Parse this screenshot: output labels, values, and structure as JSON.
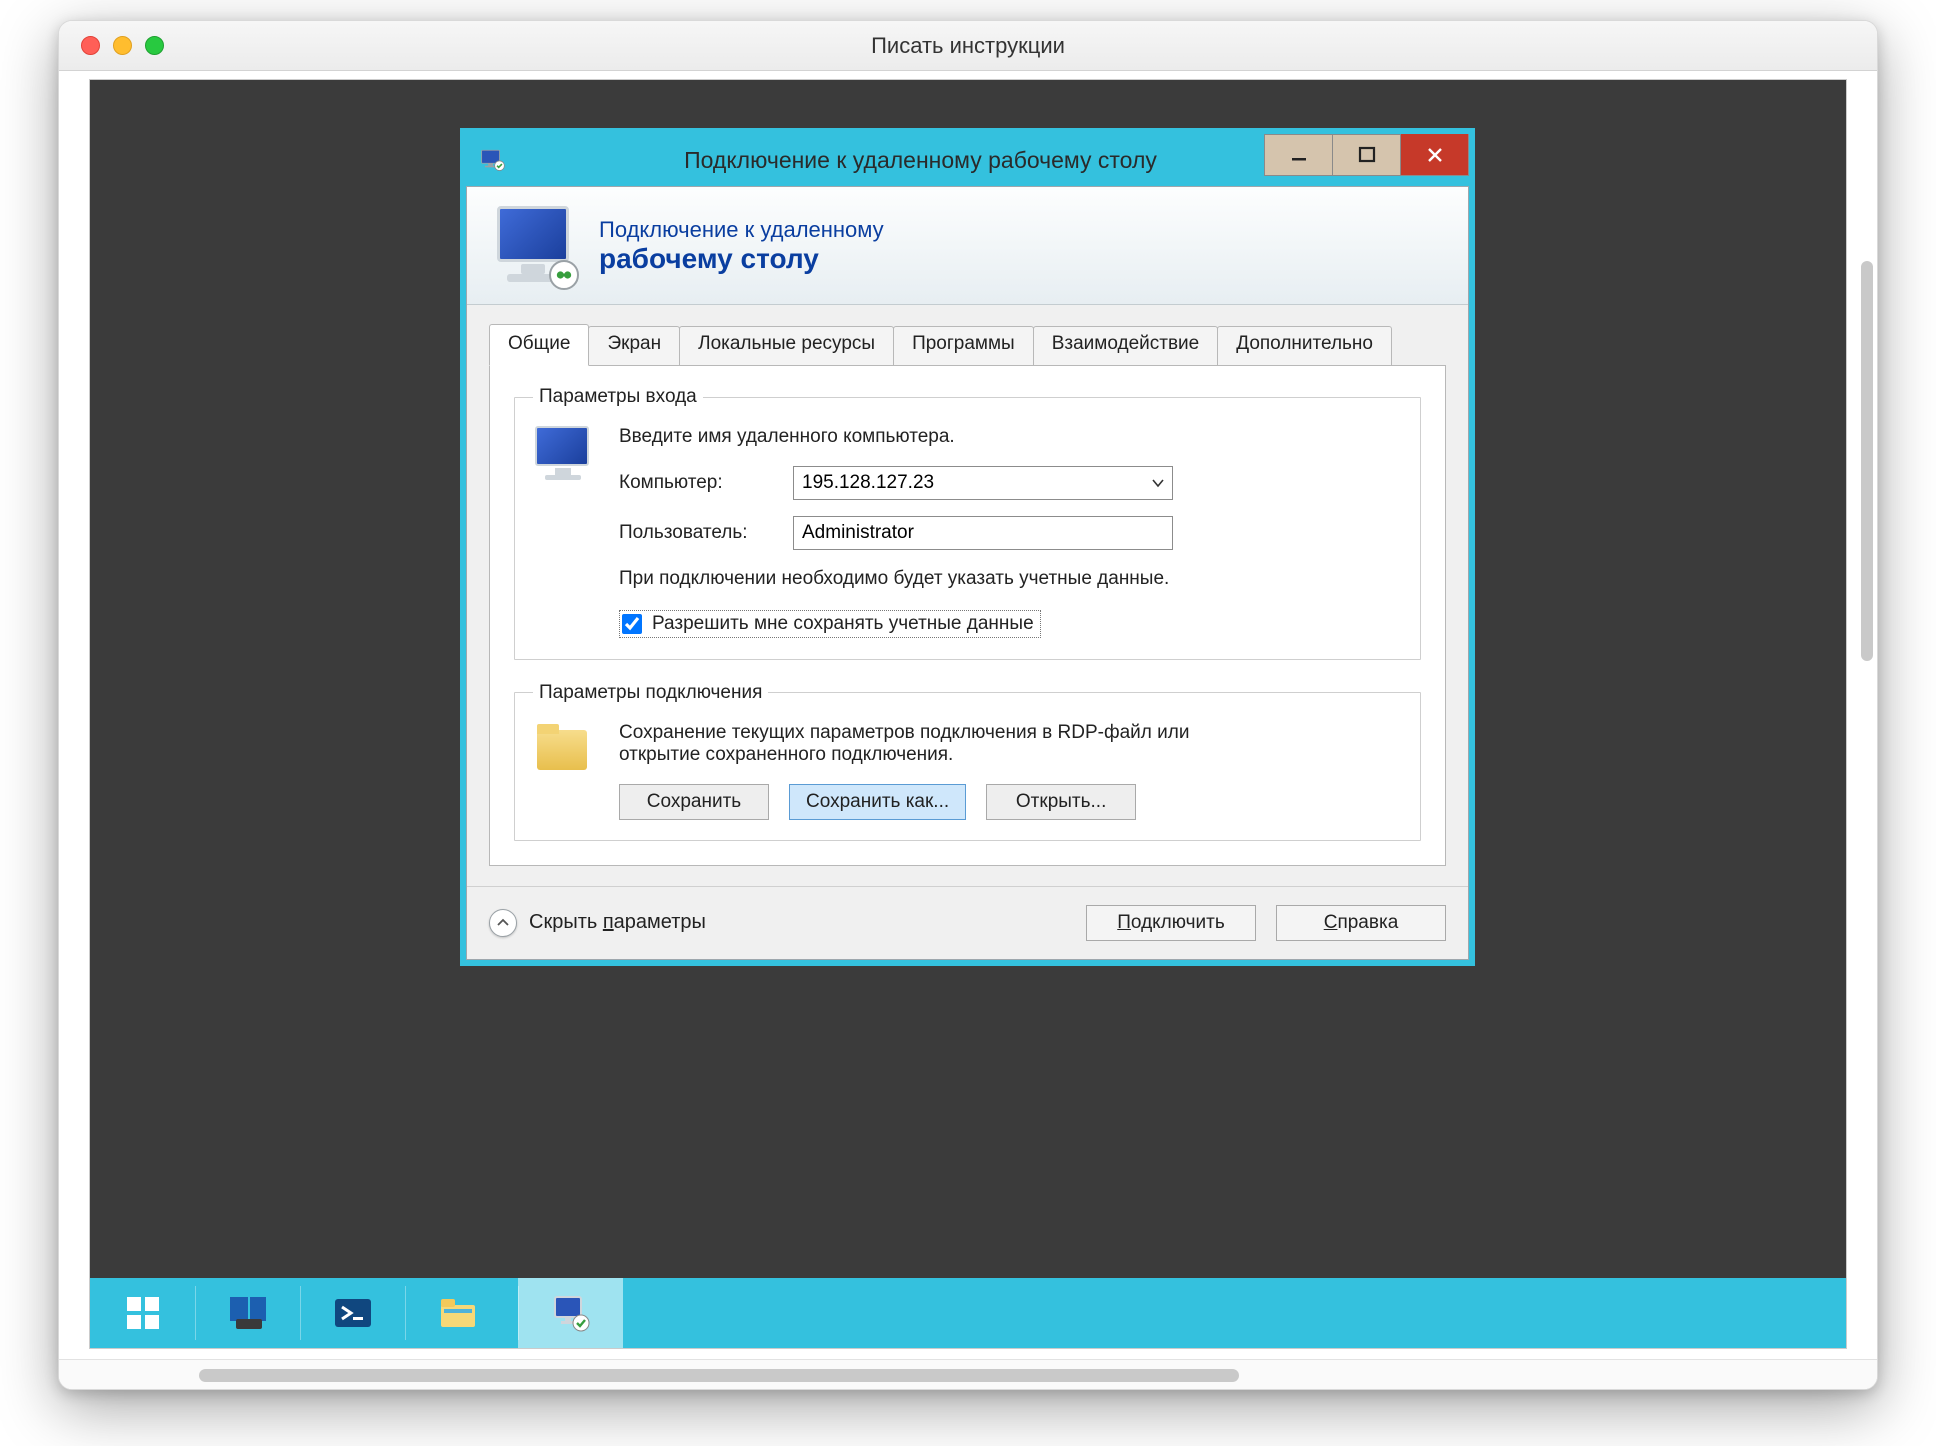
{
  "macWindow": {
    "title": "Писать инструкции"
  },
  "rdp": {
    "windowTitle": "Подключение к удаленному рабочему столу",
    "headerLine1": "Подключение к удаленному",
    "headerLine2": "рабочему столу",
    "tabs": {
      "general": "Общие",
      "screen": "Экран",
      "localResources": "Локальные ресурсы",
      "programs": "Программы",
      "experience": "Взаимодействие",
      "advanced": "Дополнительно"
    },
    "login": {
      "legend": "Параметры входа",
      "intro": "Введите имя удаленного компьютера.",
      "computerLabel": "Компьютер:",
      "computerValue": "195.128.127.23",
      "userLabel": "Пользователь:",
      "userValue": "Administrator",
      "hint": "При подключении необходимо будет указать учетные данные.",
      "allowSaveCreds": "Разрешить мне сохранять учетные данные",
      "allowSaveChecked": true
    },
    "connection": {
      "legend": "Параметры подключения",
      "intro": "Сохранение текущих параметров подключения в RDP-файл или открытие сохраненного подключения.",
      "save": "Сохранить",
      "saveAs": "Сохранить как...",
      "open": "Открыть..."
    },
    "footer": {
      "collapse_pre": "Скрыть ",
      "collapse_u": "п",
      "collapse_post": "араметры",
      "connect_u": "П",
      "connect_post": "одключить",
      "help_u": "С",
      "help_post": "правка"
    }
  }
}
